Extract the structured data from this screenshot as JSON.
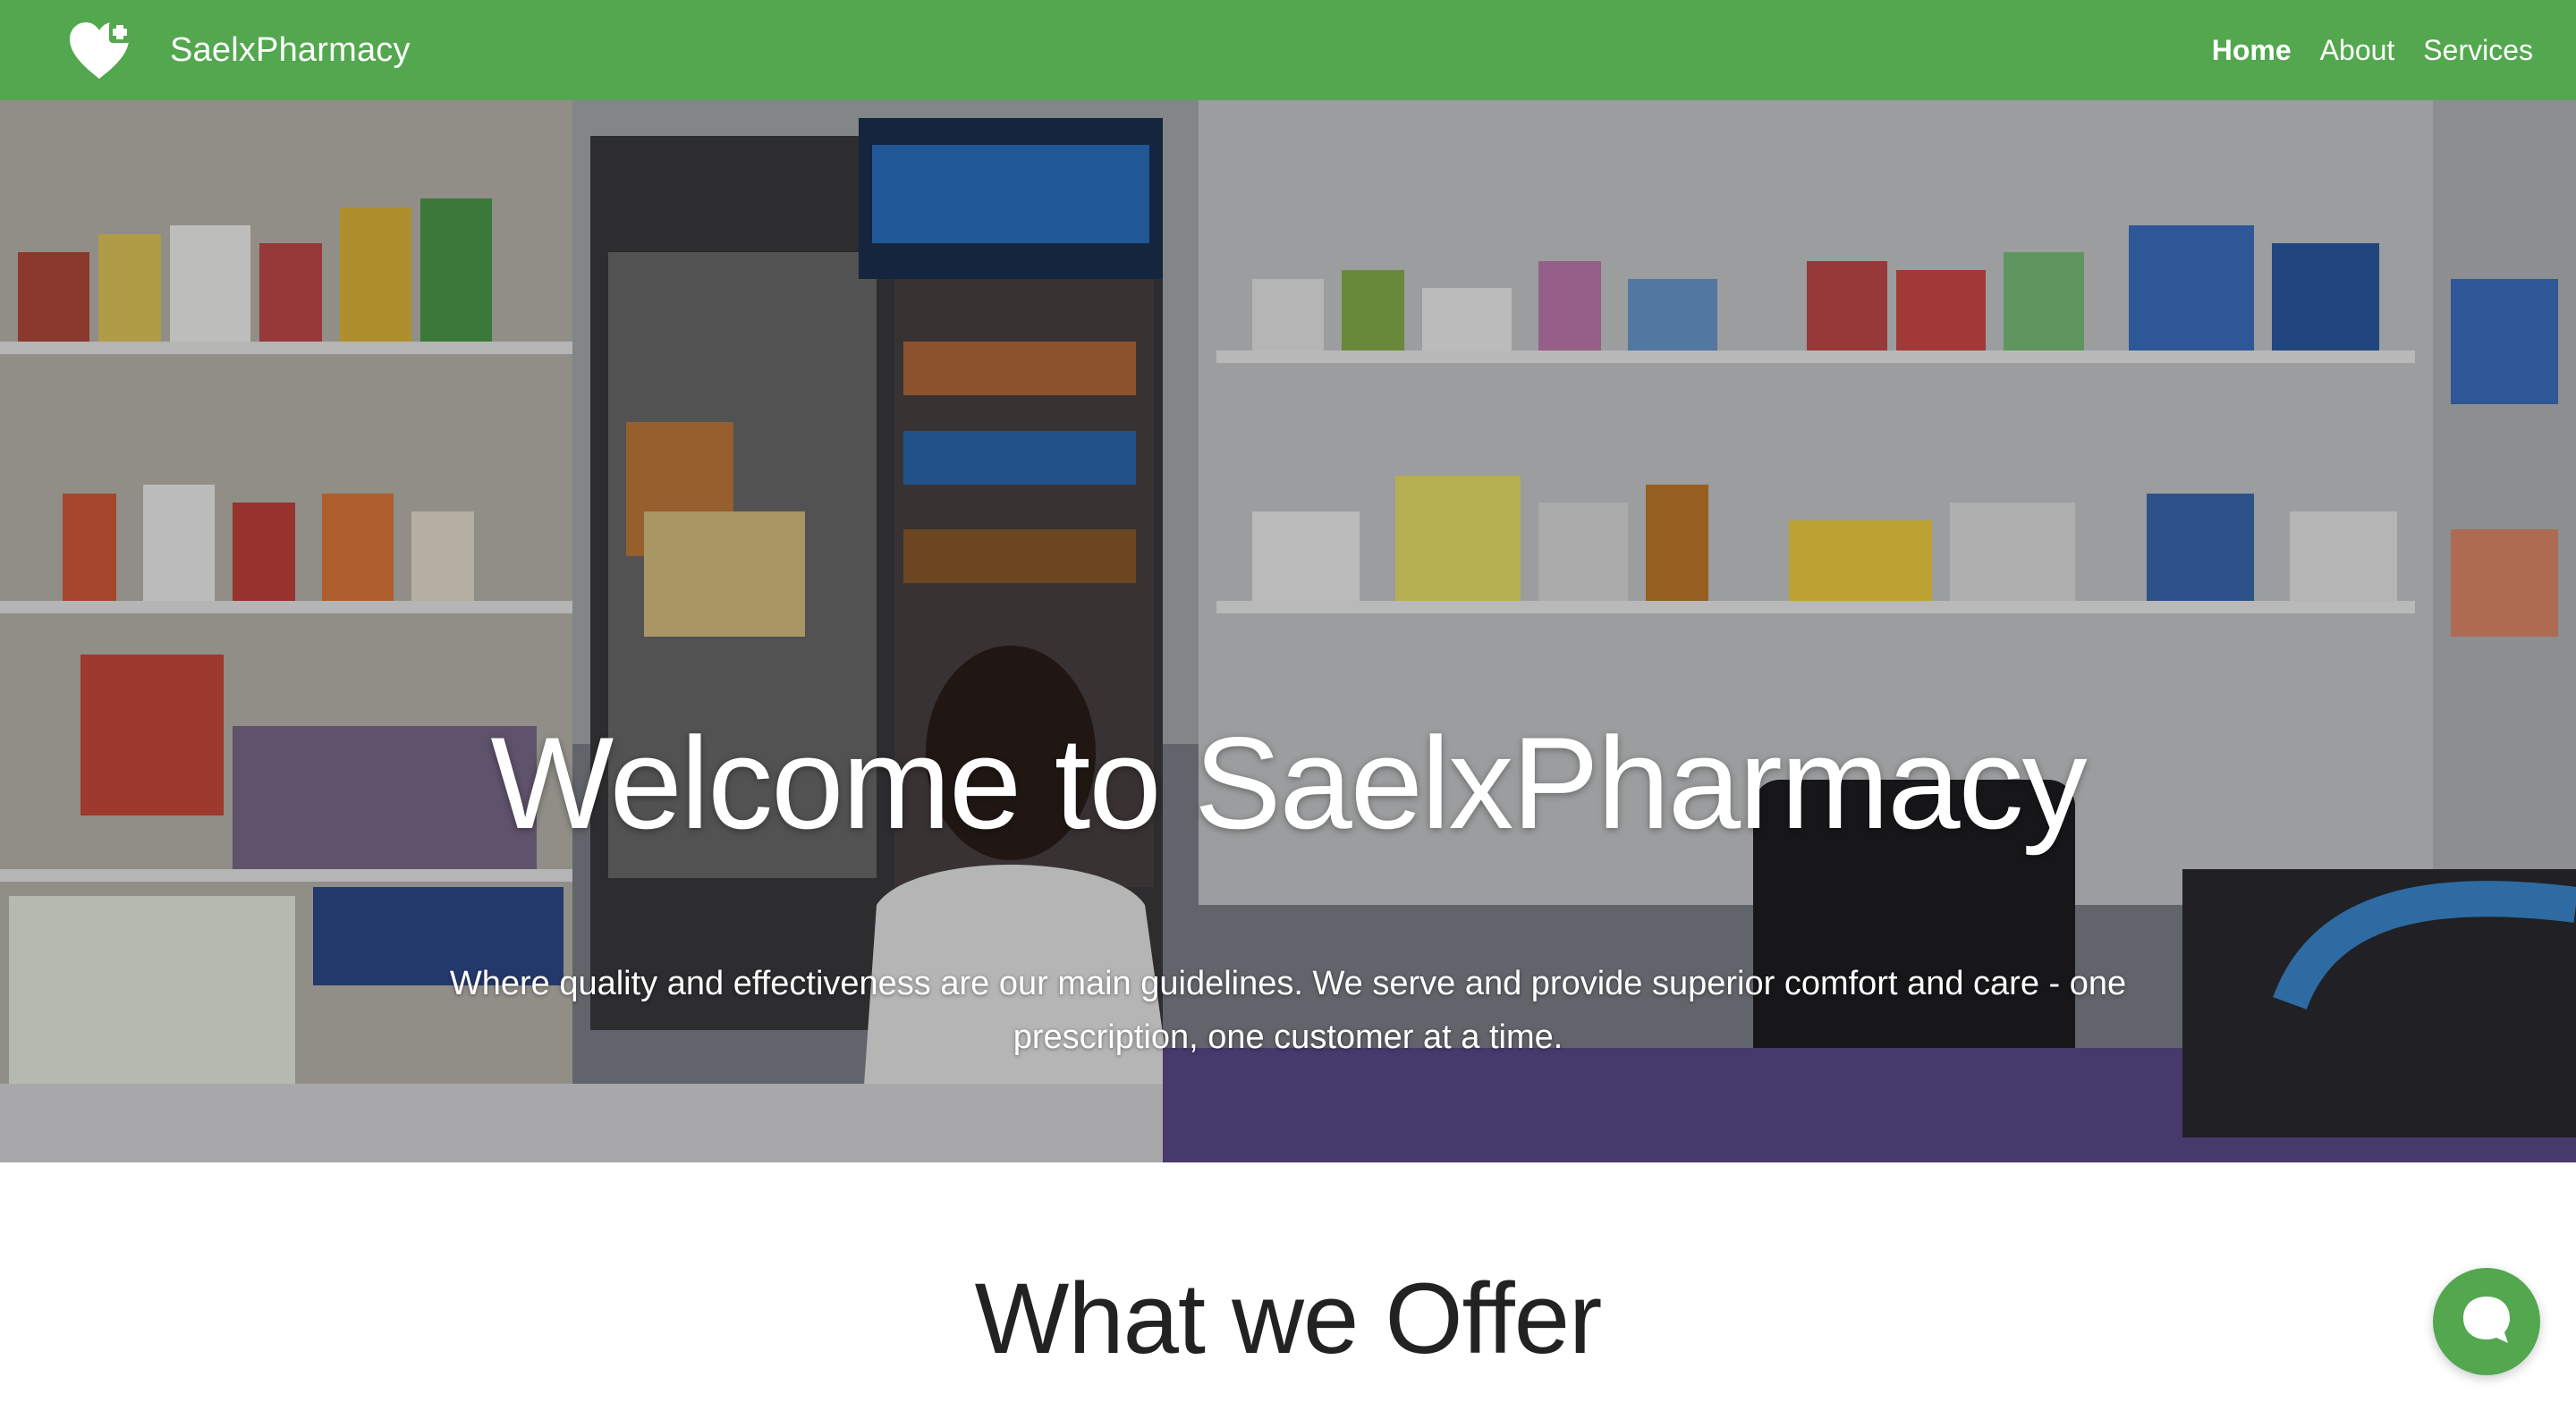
{
  "colors": {
    "brand_green": "#53a74f",
    "text_white": "#ffffff",
    "heading_dark": "#222222"
  },
  "navbar": {
    "brand_icon": "heart-plus-icon",
    "brand_name": "SaelxPharmacy",
    "links": [
      {
        "label": "Home",
        "active": true
      },
      {
        "label": "About",
        "active": false
      },
      {
        "label": "Services",
        "active": false
      }
    ]
  },
  "hero": {
    "title": "Welcome to SaelxPharmacy",
    "subtitle": "Where quality and effectiveness are our main guidelines. We serve and provide superior comfort and care - one prescription, one customer at a time."
  },
  "offer": {
    "title": "What we Offer"
  },
  "chat": {
    "icon": "chat-bubble-icon"
  }
}
